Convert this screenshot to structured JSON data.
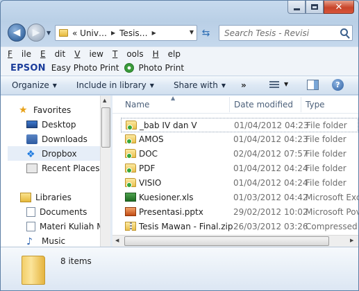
{
  "window": {
    "caption": {
      "minimize": "minimize",
      "maximize": "maximize",
      "close": "✕"
    }
  },
  "address": {
    "crumbs": [
      "« Univ…",
      "Tesis…"
    ]
  },
  "search": {
    "placeholder": "Search Tesis - Revisi"
  },
  "menu": {
    "items": [
      {
        "label": "File",
        "accel": "F"
      },
      {
        "label": "Edit",
        "accel": "E"
      },
      {
        "label": "View",
        "accel": "V"
      },
      {
        "label": "Tools",
        "accel": "T"
      },
      {
        "label": "Help",
        "accel": "H"
      }
    ]
  },
  "epson": {
    "brand": "EPSON",
    "product": "Easy Photo Print",
    "photo": "Photo Print"
  },
  "toolbar": {
    "organize": "Organize",
    "include": "Include in library",
    "share": "Share with",
    "more": "»"
  },
  "nav": {
    "favorites": "Favorites",
    "desktop": "Desktop",
    "downloads": "Downloads",
    "dropbox": "Dropbox",
    "recent": "Recent Places",
    "libraries": "Libraries",
    "documents": "Documents",
    "materi": "Materi Kuliah M",
    "music": "Music"
  },
  "columns": {
    "name": "Name",
    "date": "Date modified",
    "type": "Type"
  },
  "files": [
    {
      "name": "_bab IV dan V",
      "date": "01/04/2012 04:23",
      "type": "File folder",
      "icon": "folder-icon"
    },
    {
      "name": "AMOS",
      "date": "01/04/2012 04:23",
      "type": "File folder",
      "icon": "folder-icon"
    },
    {
      "name": "DOC",
      "date": "02/04/2012 07:57",
      "type": "File folder",
      "icon": "folder-icon"
    },
    {
      "name": "PDF",
      "date": "01/04/2012 04:24",
      "type": "File folder",
      "icon": "folder-icon"
    },
    {
      "name": "VISIO",
      "date": "01/04/2012 04:24",
      "type": "File folder",
      "icon": "folder-icon"
    },
    {
      "name": "Kuesioner.xls",
      "date": "01/03/2012 04:42",
      "type": "Microsoft Exc",
      "icon": "excel-icon"
    },
    {
      "name": "Presentasi.pptx",
      "date": "29/02/2012 10:02",
      "type": "Microsoft Pov",
      "icon": "powerpoint-icon"
    },
    {
      "name": "Tesis Mawan - Final.zip",
      "date": "26/03/2012 03:26",
      "type": "Compressed",
      "icon": "zip-icon"
    }
  ],
  "details": {
    "count": "8 items"
  }
}
